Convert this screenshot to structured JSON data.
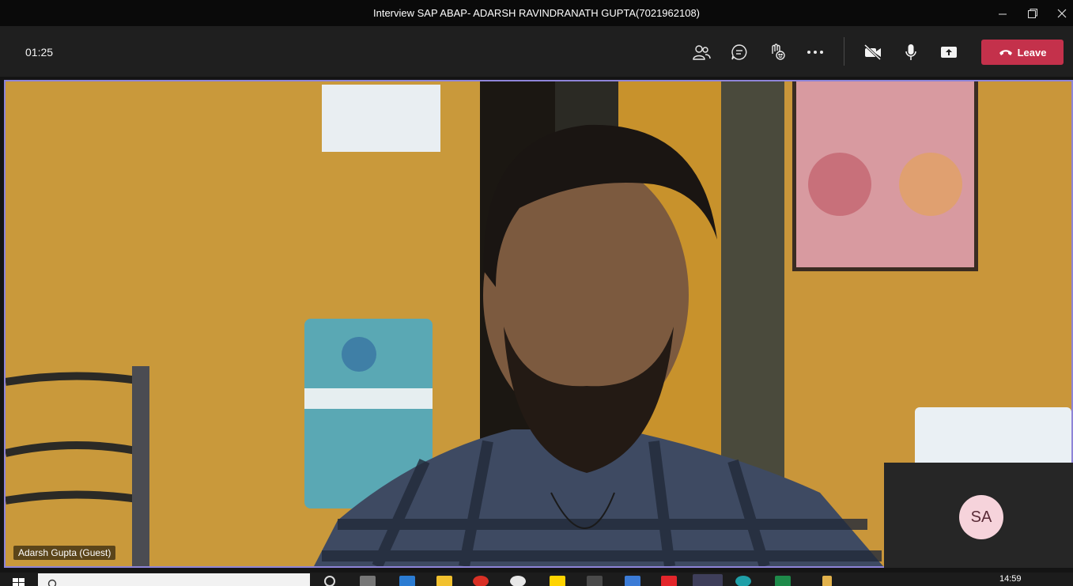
{
  "window": {
    "title": "Interview SAP ABAP- ADARSH RAVINDRANATH GUPTA(7021962108)",
    "controls": [
      "minimize-icon",
      "maximize-icon",
      "close-icon"
    ]
  },
  "toolbar": {
    "timer": "01:25",
    "buttons": [
      "participants-icon",
      "chat-icon",
      "reactions-icon",
      "more-options-icon",
      "camera-off-icon",
      "microphone-icon",
      "share-screen-icon"
    ],
    "leave_label": "Leave",
    "leave_color": "#c4314b"
  },
  "stage": {
    "participant_name": "Adarsh Gupta (Guest)",
    "active_border_color": "#8e84d8",
    "self_initials": "SA",
    "self_avatar_color": "#f6d3db"
  },
  "taskbar": {
    "time": "14:59"
  }
}
